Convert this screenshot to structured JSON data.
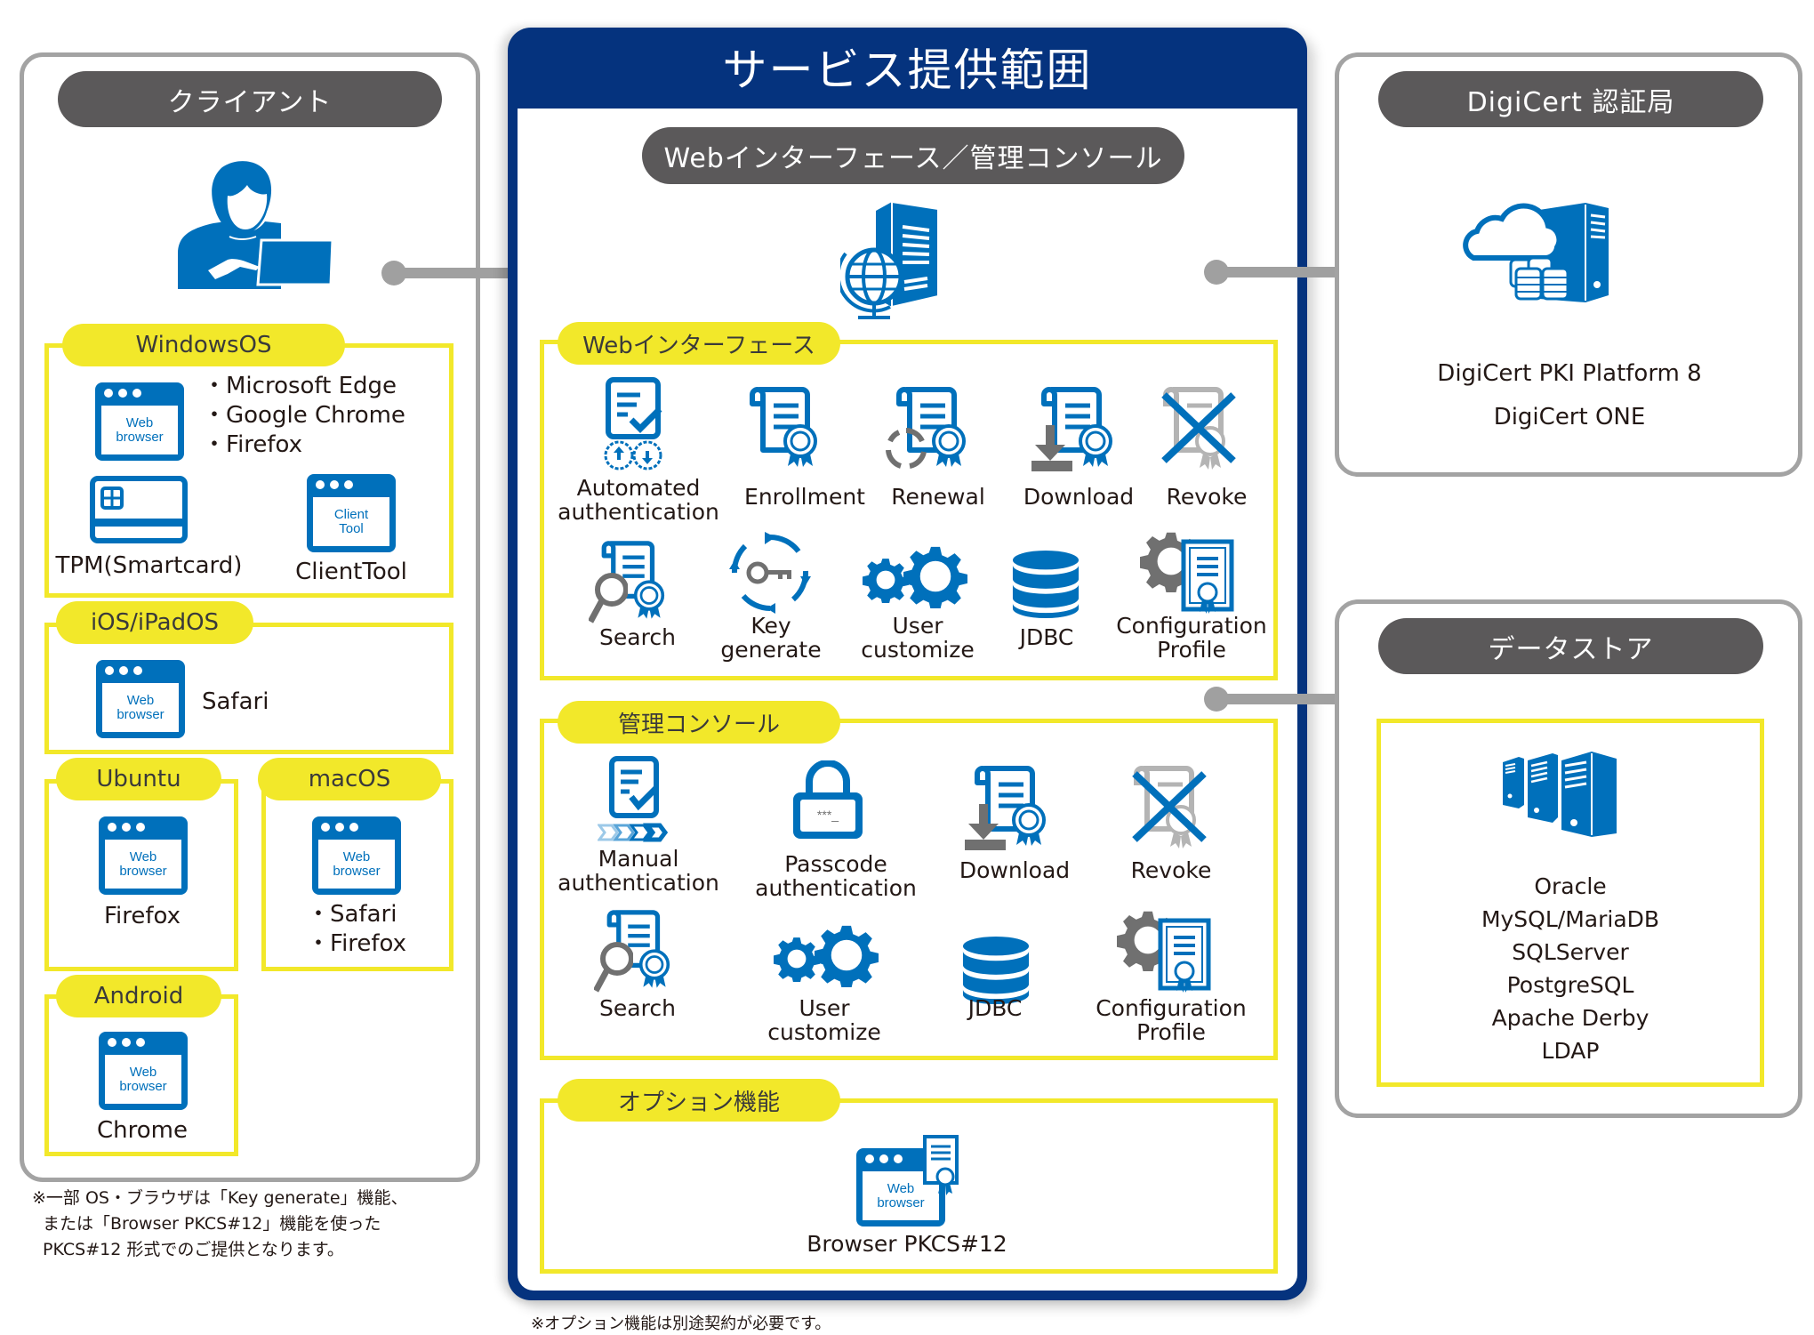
{
  "client": {
    "title": "クライアント",
    "groups": {
      "windows": {
        "label": "WindowsOS",
        "browsers": [
          "・Microsoft Edge",
          "・Google Chrome",
          "・Firefox"
        ],
        "tpm_label": "TPM(Smartcard)",
        "clienttool_label": "ClientTool",
        "clienttool_icon_text": [
          "Client",
          "Tool"
        ]
      },
      "ios": {
        "label": "iOS/iPadOS",
        "browsers": [
          "Safari"
        ]
      },
      "ubuntu": {
        "label": "Ubuntu",
        "browsers": [
          "Firefox"
        ]
      },
      "macos": {
        "label": "macOS",
        "browsers": [
          "・Safari",
          "・Firefox"
        ]
      },
      "android": {
        "label": "Android",
        "browsers": [
          "Chrome"
        ]
      }
    },
    "browser_icon_text": [
      "Web",
      "browser"
    ],
    "footnote": [
      "※一部 OS・ブラウザは「Key generate」機能、",
      "または「Browser PKCS#12」機能を使った",
      "PKCS#12 形式でのご提供となります。"
    ]
  },
  "service": {
    "title": "サービス提供範囲",
    "subtitle": "Webインターフェース／管理コンソール",
    "web_interface": {
      "label": "Webインターフェース",
      "items": [
        {
          "icon": "automated-auth-icon",
          "label": [
            "Automated",
            "authentication"
          ]
        },
        {
          "icon": "enrollment-icon",
          "label": [
            "Enrollment"
          ]
        },
        {
          "icon": "renewal-icon",
          "label": [
            "Renewal"
          ]
        },
        {
          "icon": "download-icon",
          "label": [
            "Download"
          ]
        },
        {
          "icon": "revoke-icon",
          "label": [
            "Revoke"
          ]
        },
        {
          "icon": "search-icon",
          "label": [
            "Search"
          ]
        },
        {
          "icon": "key-generate-icon",
          "label": [
            "Key",
            "generate"
          ]
        },
        {
          "icon": "user-customize-icon",
          "label": [
            "User",
            "customize"
          ]
        },
        {
          "icon": "jdbc-icon",
          "label": [
            "JDBC"
          ]
        },
        {
          "icon": "configuration-profile-icon",
          "label": [
            "Configuration",
            "Profile"
          ]
        }
      ]
    },
    "admin_console": {
      "label": "管理コンソール",
      "items": [
        {
          "icon": "manual-auth-icon",
          "label": [
            "Manual",
            "authentication"
          ]
        },
        {
          "icon": "passcode-auth-icon",
          "label": [
            "Passcode",
            "authentication"
          ]
        },
        {
          "icon": "download-icon",
          "label": [
            "Download"
          ]
        },
        {
          "icon": "revoke-icon",
          "label": [
            "Revoke"
          ]
        },
        {
          "icon": "search-icon",
          "label": [
            "Search"
          ]
        },
        {
          "icon": "user-customize-icon",
          "label": [
            "User",
            "customize"
          ]
        },
        {
          "icon": "jdbc-icon",
          "label": [
            "JDBC"
          ]
        },
        {
          "icon": "configuration-profile-icon",
          "label": [
            "Configuration",
            "Profile"
          ]
        }
      ],
      "passcode_icon_text": "***_"
    },
    "options": {
      "label": "オプション機能",
      "items": [
        {
          "icon": "browser-pkcs12-icon",
          "label": [
            "Browser PKCS#12"
          ]
        }
      ]
    },
    "footnote": "※オプション機能は別途契約が必要です。"
  },
  "ca": {
    "title": "DigiCert 認証局",
    "products": [
      "DigiCert PKI Platform 8",
      "DigiCert ONE"
    ]
  },
  "datastore": {
    "title": "データストア",
    "databases": [
      "Oracle",
      "MySQL/MariaDB",
      "SQLServer",
      "PostgreSQL",
      "Apache Derby",
      "LDAP"
    ]
  },
  "colors": {
    "navy": "#05337e",
    "icon_blue": "#0070bb",
    "yellow": "#f2e82a",
    "pill_dark": "#5b595a",
    "connector_gray": "#a0a0a0",
    "icon_gray": "#707070"
  }
}
